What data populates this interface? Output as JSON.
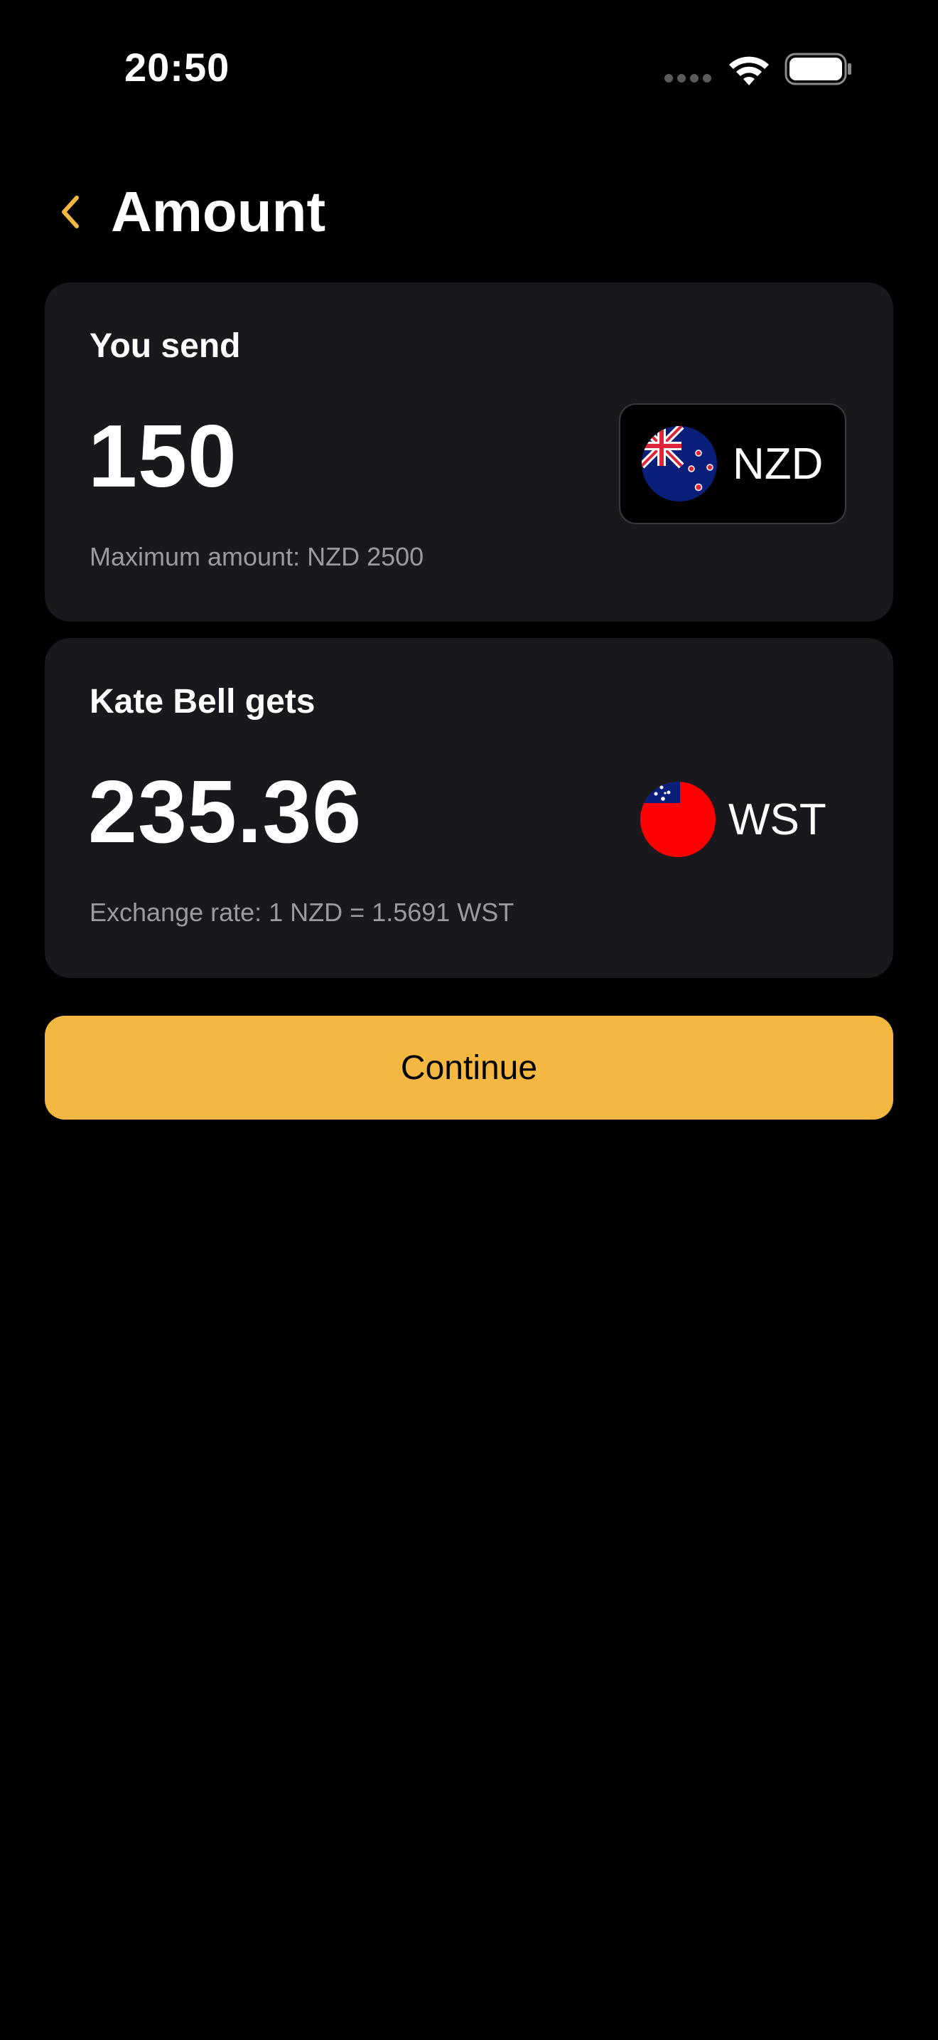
{
  "status_bar": {
    "time": "20:50",
    "icons": [
      "signal-icon",
      "wifi-icon",
      "battery-icon"
    ]
  },
  "header": {
    "title": "Amount",
    "back_icon": "chevron-left-icon"
  },
  "send": {
    "label": "You send",
    "amount": "150",
    "currency_code": "NZD",
    "currency_flag": "new-zealand-flag-icon",
    "note": "Maximum amount: NZD 2500"
  },
  "receive": {
    "label": "Kate Bell gets",
    "amount": "235.36",
    "currency_code": "WST",
    "currency_flag": "samoa-flag-icon",
    "note": "Exchange rate: 1 NZD = 1.5691 WST"
  },
  "actions": {
    "continue_label": "Continue"
  },
  "colors": {
    "background": "#000000",
    "card": "#19191d",
    "accent": "#f3b742",
    "muted_text": "#9a9aa0"
  }
}
